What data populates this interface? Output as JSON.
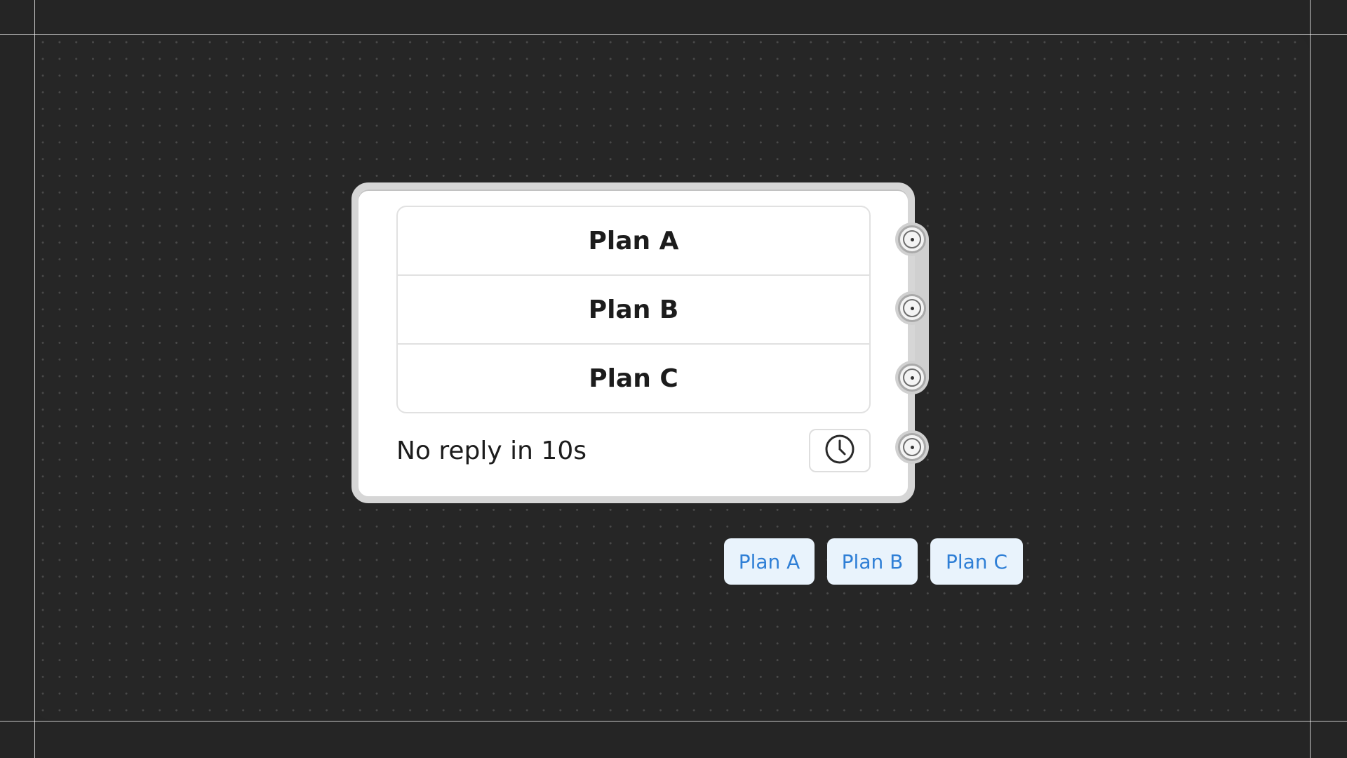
{
  "question_node": {
    "options": [
      {
        "label": "Plan A"
      },
      {
        "label": "Plan B"
      },
      {
        "label": "Plan C"
      }
    ],
    "timeout_label": "No reply in 10s",
    "timer_icon": "clock-icon"
  },
  "ports": [
    {
      "name": "output-port-plan-a"
    },
    {
      "name": "output-port-plan-b"
    },
    {
      "name": "output-port-plan-c"
    },
    {
      "name": "output-port-timeout"
    }
  ],
  "quick_replies": [
    {
      "label": "Plan A"
    },
    {
      "label": "Plan B"
    },
    {
      "label": "Plan C"
    }
  ],
  "colors": {
    "background": "#252525",
    "node_border": "#d6d6d6",
    "chip_background": "#e9f3fc",
    "chip_text": "#2f7fd6"
  }
}
